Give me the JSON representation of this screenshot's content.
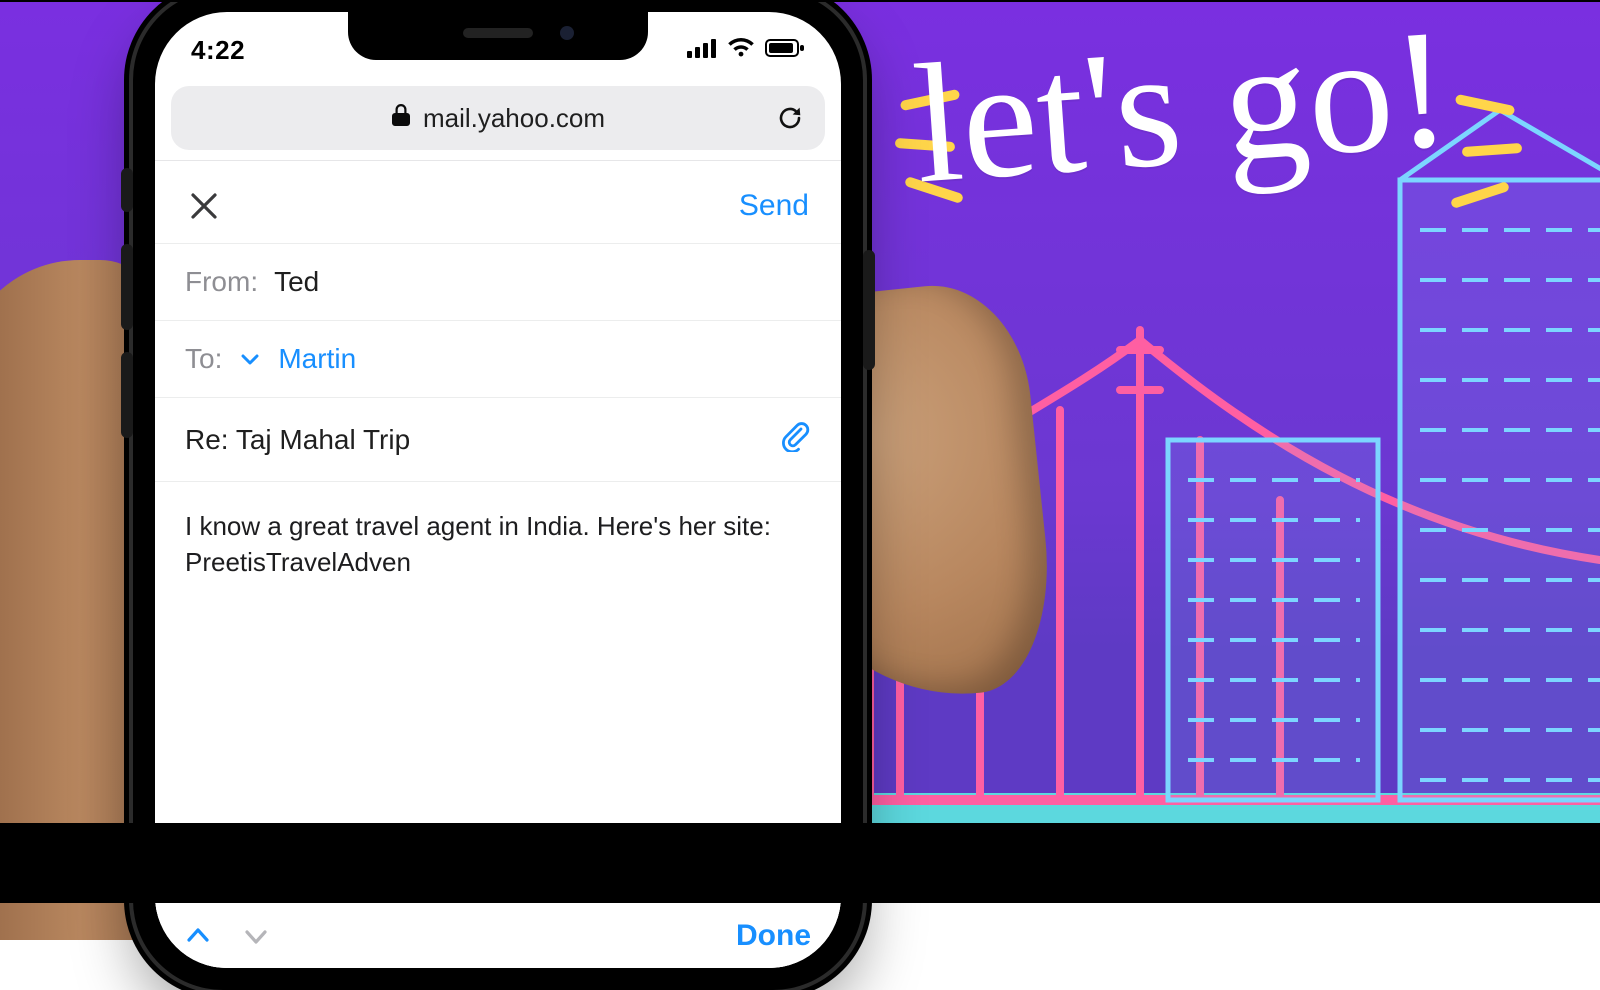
{
  "promo": {
    "headline": "let's go!"
  },
  "statusbar": {
    "time": "4:22"
  },
  "browser": {
    "url": "mail.yahoo.com"
  },
  "compose": {
    "send_label": "Send",
    "from_label": "From:",
    "from_value": "Ted",
    "to_label": "To:",
    "to_value": "Martin",
    "subject": "Re: Taj Mahal Trip",
    "body": "I know a great travel agent in India. Here's her site: PreetisTravelAdven"
  },
  "keyboard_bar": {
    "done_label": "Done"
  }
}
